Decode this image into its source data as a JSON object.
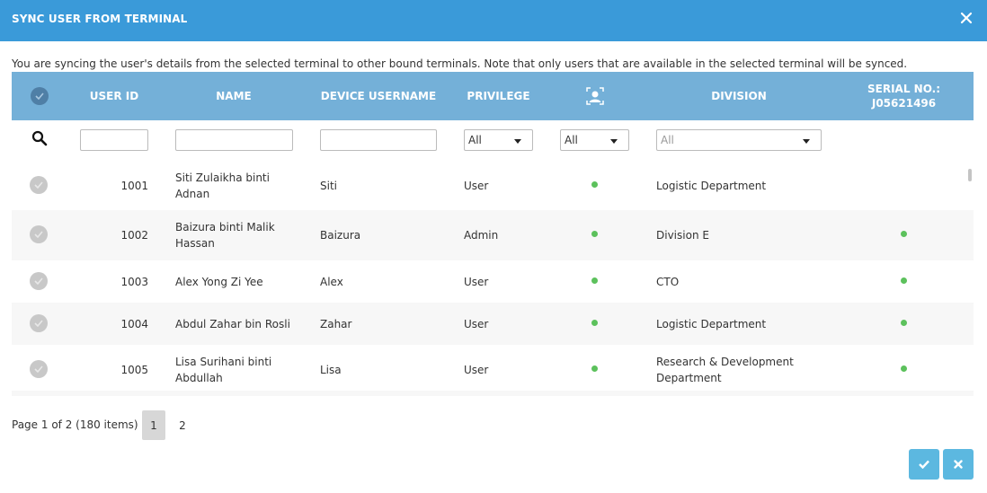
{
  "dialog": {
    "title": "SYNC USER FROM TERMINAL",
    "note": "You are syncing the user's details from the selected terminal to other bound terminals. Note that only users that are available in the selected terminal will be synced."
  },
  "columns": {
    "user_id": "USER ID",
    "name": "NAME",
    "device_username": "DEVICE USERNAME",
    "privilege": "PRIVILEGE",
    "face_icon": "face-scan-icon",
    "division": "DIVISION",
    "serial_line1": "SERIAL NO.:",
    "serial_line2": "J05621496"
  },
  "filters": {
    "privilege_selected": "All",
    "face_selected": "All",
    "division_selected": "All"
  },
  "rows": [
    {
      "user_id": "1001",
      "name_line1": "Siti Zulaikha binti",
      "name_line2": "Adnan",
      "device_username": "Siti",
      "privilege": "User",
      "division_line1": "Logistic Department",
      "division_line2": "",
      "serial": false
    },
    {
      "user_id": "1002",
      "name_line1": "Baizura binti Malik",
      "name_line2": "Hassan",
      "device_username": "Baizura",
      "privilege": "Admin",
      "division_line1": "Division E",
      "division_line2": "",
      "serial": true
    },
    {
      "user_id": "1003",
      "name_line1": "Alex Yong Zi Yee",
      "name_line2": "",
      "device_username": "Alex",
      "privilege": "User",
      "division_line1": "CTO",
      "division_line2": "",
      "serial": true
    },
    {
      "user_id": "1004",
      "name_line1": "Abdul Zahar bin Rosli",
      "name_line2": "",
      "device_username": "Zahar",
      "privilege": "User",
      "division_line1": "Logistic Department",
      "division_line2": "",
      "serial": true
    },
    {
      "user_id": "1005",
      "name_line1": "Lisa Surihani binti",
      "name_line2": "Abdullah",
      "device_username": "Lisa",
      "privilege": "User",
      "division_line1": "Research & Development",
      "division_line2": "Department",
      "serial": true
    }
  ],
  "pagination": {
    "summary": "Page 1 of 2 (180 items)",
    "pages": [
      "1",
      "2"
    ],
    "current": "1"
  },
  "colors": {
    "titlebar": "#3a9ad9",
    "header": "#74b0d8",
    "status_dot": "#5cc15c",
    "action_button": "#5cb8e0"
  }
}
